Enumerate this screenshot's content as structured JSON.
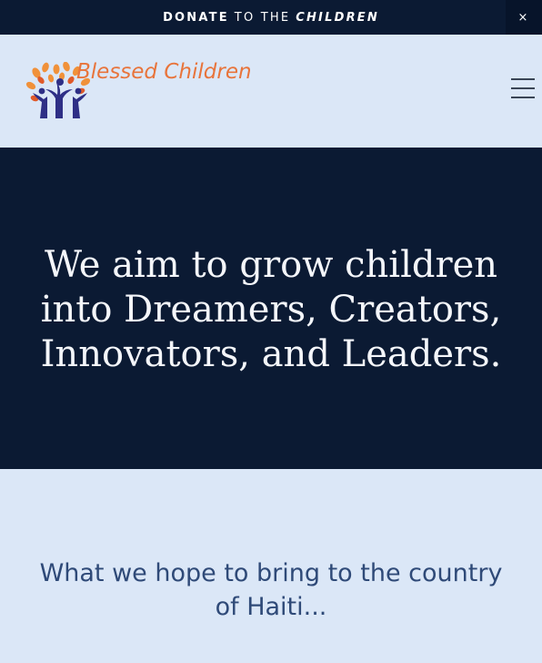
{
  "announcement": {
    "bold_text": "DONATE",
    "middle_text": "TO THE",
    "emphasis_text": "CHILDREN",
    "close_label": "×"
  },
  "header": {
    "brand_name": "Blessed Children",
    "logo_icon": "tree-with-children-icon",
    "menu_icon": "hamburger-menu-icon"
  },
  "hero": {
    "headline": "We aim to grow children into Dreamers, Creators, Innovators, and Leaders."
  },
  "section": {
    "heading": "What we hope to bring to the country of Haiti..."
  },
  "colors": {
    "navy": "#0b1a33",
    "light_blue": "#dbe7f7",
    "brand_orange": "#e8743b",
    "heading_blue": "#2f4a78"
  }
}
